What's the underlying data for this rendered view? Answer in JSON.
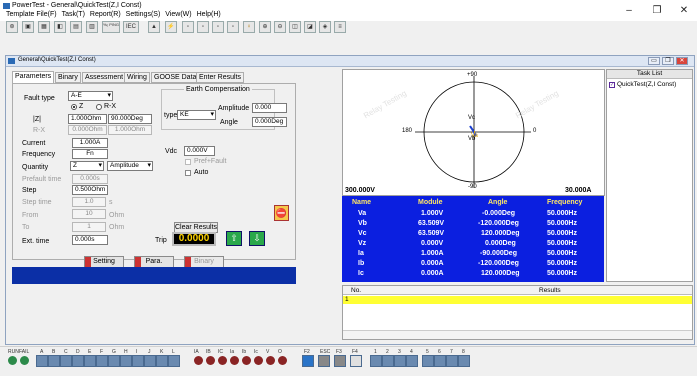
{
  "app": {
    "title": "PowerTest - General\\QuickTest(Z,I Const)",
    "menu": [
      "Template File(F)",
      "Task(T)",
      "Report(R)",
      "Settings(S)",
      "View(W)",
      "Help(H)"
    ],
    "toolbar_text": [
      "%ₒ PING",
      "IEC"
    ],
    "window_controls": [
      "–",
      "❐",
      "✕"
    ]
  },
  "window": {
    "title": "General\\QuickTest(Z,I Const)",
    "controls": [
      "▭",
      "❐",
      "✕"
    ]
  },
  "tabs": [
    "Parameters",
    "Binary",
    "Assessment",
    "Wiring",
    "GOOSE Data",
    "Enter Results"
  ],
  "params": {
    "fault_type_label": "Fault type",
    "fault_type_value": "A-E",
    "radio_z": "Z",
    "radio_rx": "R-X",
    "z_label": "|Z|",
    "z_mag": "1.000Ohm",
    "z_angle": "90.000Deg",
    "rx_label": "R-X",
    "r_value": "0.000Ohm",
    "x_value": "1.000Ohm",
    "current_label": "Current",
    "current_value": "1.000A",
    "frequency_label": "Frequency",
    "frequency_value": "Fn",
    "quantity_label": "Quantity",
    "quantity_value": "Z",
    "quantity_mode": "Amplitude",
    "prefault_label": "Prefault time",
    "prefault_value": "0.000s",
    "step_label": "Step",
    "step_value": "0.500Ohm",
    "steptime_label": "Step time",
    "steptime_value": "1.0",
    "steptime_unit": "s",
    "from_label": "From",
    "from_value": "10",
    "from_unit": "Ohm",
    "to_label": "To",
    "to_value": "1",
    "to_unit": "Ohm",
    "ext_label": "Ext. time",
    "ext_value": "0.000s",
    "earth_title": "Earth Compensation",
    "type_label": "type",
    "type_value": "KE",
    "amplitude_label": "Amplitude",
    "amplitude_value": "0.000",
    "angle_label": "Angle",
    "angle_value": "0.000Deg",
    "vdc_label": "Vdc",
    "vdc_value": "0.000V",
    "prefault_chk": "Pref+Fault",
    "auto_chk": "Auto",
    "clear_results": "Clear Results",
    "trip_label": "Trip",
    "trip_value": "0.0000"
  },
  "buttons": {
    "setting": "Setting",
    "para": "Para.",
    "binary": "Binary"
  },
  "phasor": {
    "top": "+90",
    "bottom": "-90",
    "left": "180",
    "right": "0",
    "va": "Va",
    "vc": "Vc",
    "vb": "Vb",
    "v_scale": "300.000V",
    "a_scale": "30.000A",
    "watermark": "Relay Testing"
  },
  "measure": {
    "headers": [
      "Name",
      "Module",
      "Angle",
      "Frequency"
    ],
    "rows": [
      [
        "Va",
        "1.000V",
        "-0.000Deg",
        "50.000Hz"
      ],
      [
        "Vb",
        "63.509V",
        "-120.000Deg",
        "50.000Hz"
      ],
      [
        "Vc",
        "63.509V",
        "120.000Deg",
        "50.000Hz"
      ],
      [
        "Vz",
        "0.000V",
        "0.000Deg",
        "50.000Hz"
      ],
      [
        "Ia",
        "1.000A",
        "-90.000Deg",
        "50.000Hz"
      ],
      [
        "Ib",
        "0.000A",
        "-120.000Deg",
        "50.000Hz"
      ],
      [
        "Ic",
        "0.000A",
        "120.000Deg",
        "50.000Hz"
      ]
    ]
  },
  "tasklist": {
    "header": "Task List",
    "item": "QuickTest(Z,I Const)"
  },
  "results": {
    "col_no": "No.",
    "col_results": "Results",
    "row1": "1"
  },
  "bottom": {
    "run_label": "RUN",
    "fail_label": "FAIL",
    "binary_labels": [
      "A",
      "B",
      "C",
      "D",
      "E",
      "F",
      "G",
      "H",
      "I",
      "J",
      "K",
      "L"
    ],
    "meter_labels": [
      "IA",
      "IB",
      "IC",
      "Ia",
      "Ib",
      "Ic",
      "V",
      "O"
    ],
    "fkeys": [
      "F2",
      "ESC",
      "F3",
      "F4"
    ],
    "num_labels": [
      "1",
      "2",
      "3",
      "4",
      "5",
      "6",
      "7",
      "8"
    ]
  }
}
